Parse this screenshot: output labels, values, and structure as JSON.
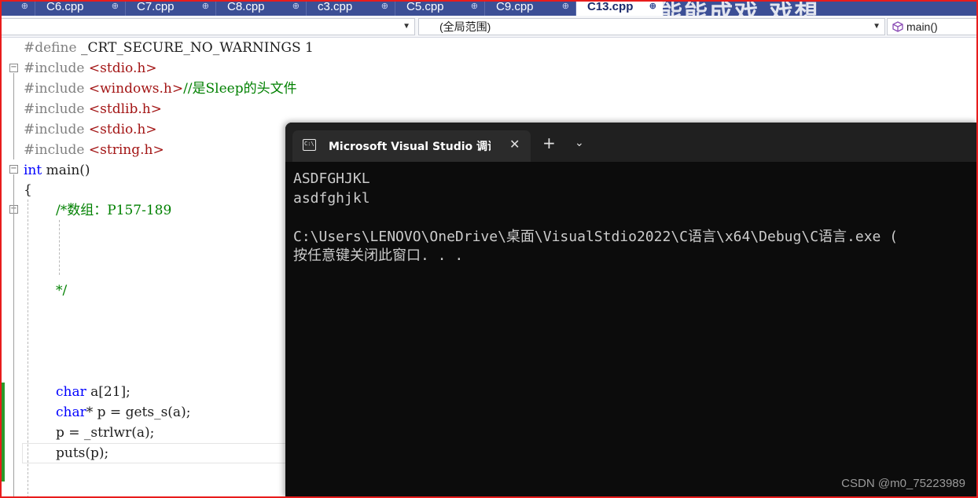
{
  "tabs": [
    {
      "label": "C6.cpp",
      "pin": "⊕"
    },
    {
      "label": "C7.cpp",
      "pin": "⊕"
    },
    {
      "label": "C8.cpp",
      "pin": "⊕"
    },
    {
      "label": "c3.cpp",
      "pin": "⊕"
    },
    {
      "label": "C5.cpp",
      "pin": "⊕"
    },
    {
      "label": "C9.cpp",
      "pin": "⊕"
    },
    {
      "label": "C13.cpp",
      "pin": "⊕",
      "active": true
    }
  ],
  "tab_overlay_text": "能能成戏 戏想",
  "navbar": {
    "scope": "(全局范围)",
    "member": "main()"
  },
  "code": {
    "l1": {
      "pp": "#define",
      "rest": " _CRT_SECURE_NO_WARNINGS 1"
    },
    "l2": {
      "pp": "#include ",
      "inc": "<stdio.h>"
    },
    "l3": {
      "pp": "#include ",
      "inc": "<windows.h>",
      "cm": "//是Sleep的头文件"
    },
    "l4": {
      "pp": "#include ",
      "inc": "<stdlib.h>"
    },
    "l5": {
      "pp": "#include ",
      "inc": "<stdio.h>"
    },
    "l6": {
      "pp": "#include ",
      "inc": "<string.h>"
    },
    "l7": {
      "kw": "int",
      "rest": " main()"
    },
    "l8": {
      "rest": "{"
    },
    "l9": {
      "cm": "/*数组：P157-189"
    },
    "l10": {
      "cm": "*/"
    },
    "l11": {
      "kw": "char",
      "rest": " a[21];"
    },
    "l12": {
      "kw": "char",
      "rest": "* p = gets_s(a);"
    },
    "l13": {
      "rest": "p = _strlwr(a);"
    },
    "l14": {
      "rest": "puts(p);"
    }
  },
  "terminal": {
    "tab_title": "Microsoft Visual Studio 调试控制台",
    "icon_label": "C:\\",
    "close": "✕",
    "new_tab": "+",
    "dropdown": "⌄",
    "lines": [
      "ASDFGHJKL",
      "asdfghjkl",
      "",
      "C:\\Users\\LENOVO\\OneDrive\\桌面\\VisualStdio2022\\C语言\\x64\\Debug\\C语言.exe (",
      "按任意键关闭此窗口. . ."
    ]
  },
  "watermark_csdn": "CSDN @m0_75223989",
  "colors": {
    "tab_strip": "#3c4f96",
    "active_tab": "#ffffff",
    "keyword": "#0000ff",
    "include_path": "#a31515",
    "comment": "#008000",
    "preprocessor": "#808080",
    "terminal_bg": "#0c0c0c",
    "change_bar": "#2b9a2b",
    "frame": "#e81c1c"
  }
}
